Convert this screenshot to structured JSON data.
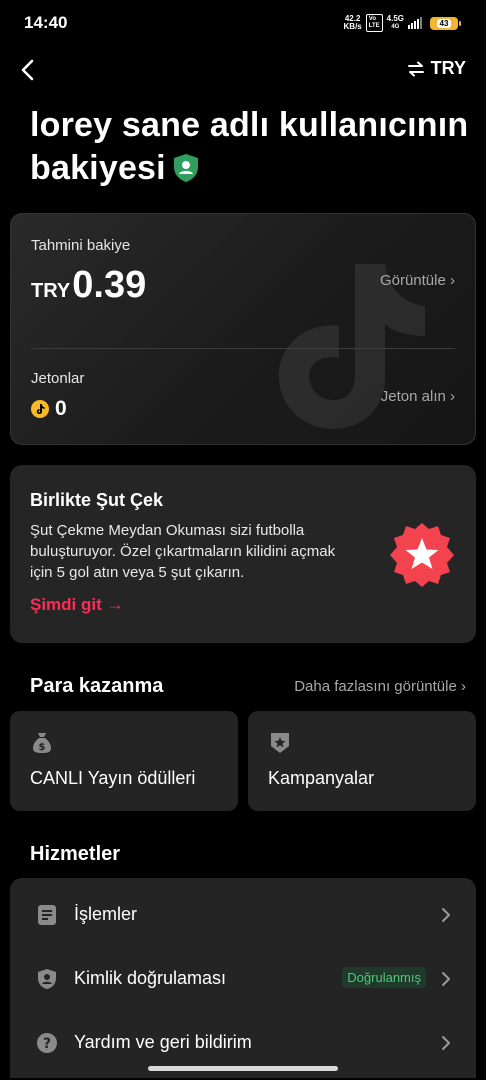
{
  "status_bar": {
    "time": "14:40",
    "speed_value": "42.2",
    "speed_unit": "KB/s",
    "net_type": "4.5G",
    "battery": "43"
  },
  "header": {
    "currency_label": "TRY"
  },
  "title": {
    "text": "lorey sane adlı kullanıcının bakiyesi"
  },
  "balance": {
    "label": "Tahmini bakiye",
    "currency": "TRY",
    "amount": "0.39",
    "view_label": "Görüntüle ›",
    "coins_label": "Jetonlar",
    "coins_value": "0",
    "buy_coins_label": "Jeton alın ›"
  },
  "promo": {
    "title": "Birlikte Şut Çek",
    "description": "Şut Çekme Meydan Okuması sizi futbolla buluşturuyor. Özel çıkartmaların kilidini açmak için 5 gol atın veya 5 şut çıkarın.",
    "cta": "Şimdi git →"
  },
  "earn": {
    "heading": "Para kazanma",
    "more_label": "Daha fazlasını görüntüle ›",
    "tiles": [
      {
        "label": "CANLI Yayın ödülleri",
        "icon": "money-bag-icon"
      },
      {
        "label": "Kampanyalar",
        "icon": "star-badge-icon"
      }
    ]
  },
  "services": {
    "heading": "Hizmetler",
    "items": [
      {
        "label": "İşlemler",
        "icon": "document-icon"
      },
      {
        "label": "Kimlik doğrulaması",
        "icon": "shield-person-icon",
        "badge": "Doğrulanmış"
      },
      {
        "label": "Yardım ve geri bildirim",
        "icon": "help-icon"
      }
    ]
  },
  "colors": {
    "accent": "#fe2c55",
    "verified": "#4fc77a",
    "coin": "#f7b924",
    "background": "#000000",
    "card": "#242424"
  }
}
